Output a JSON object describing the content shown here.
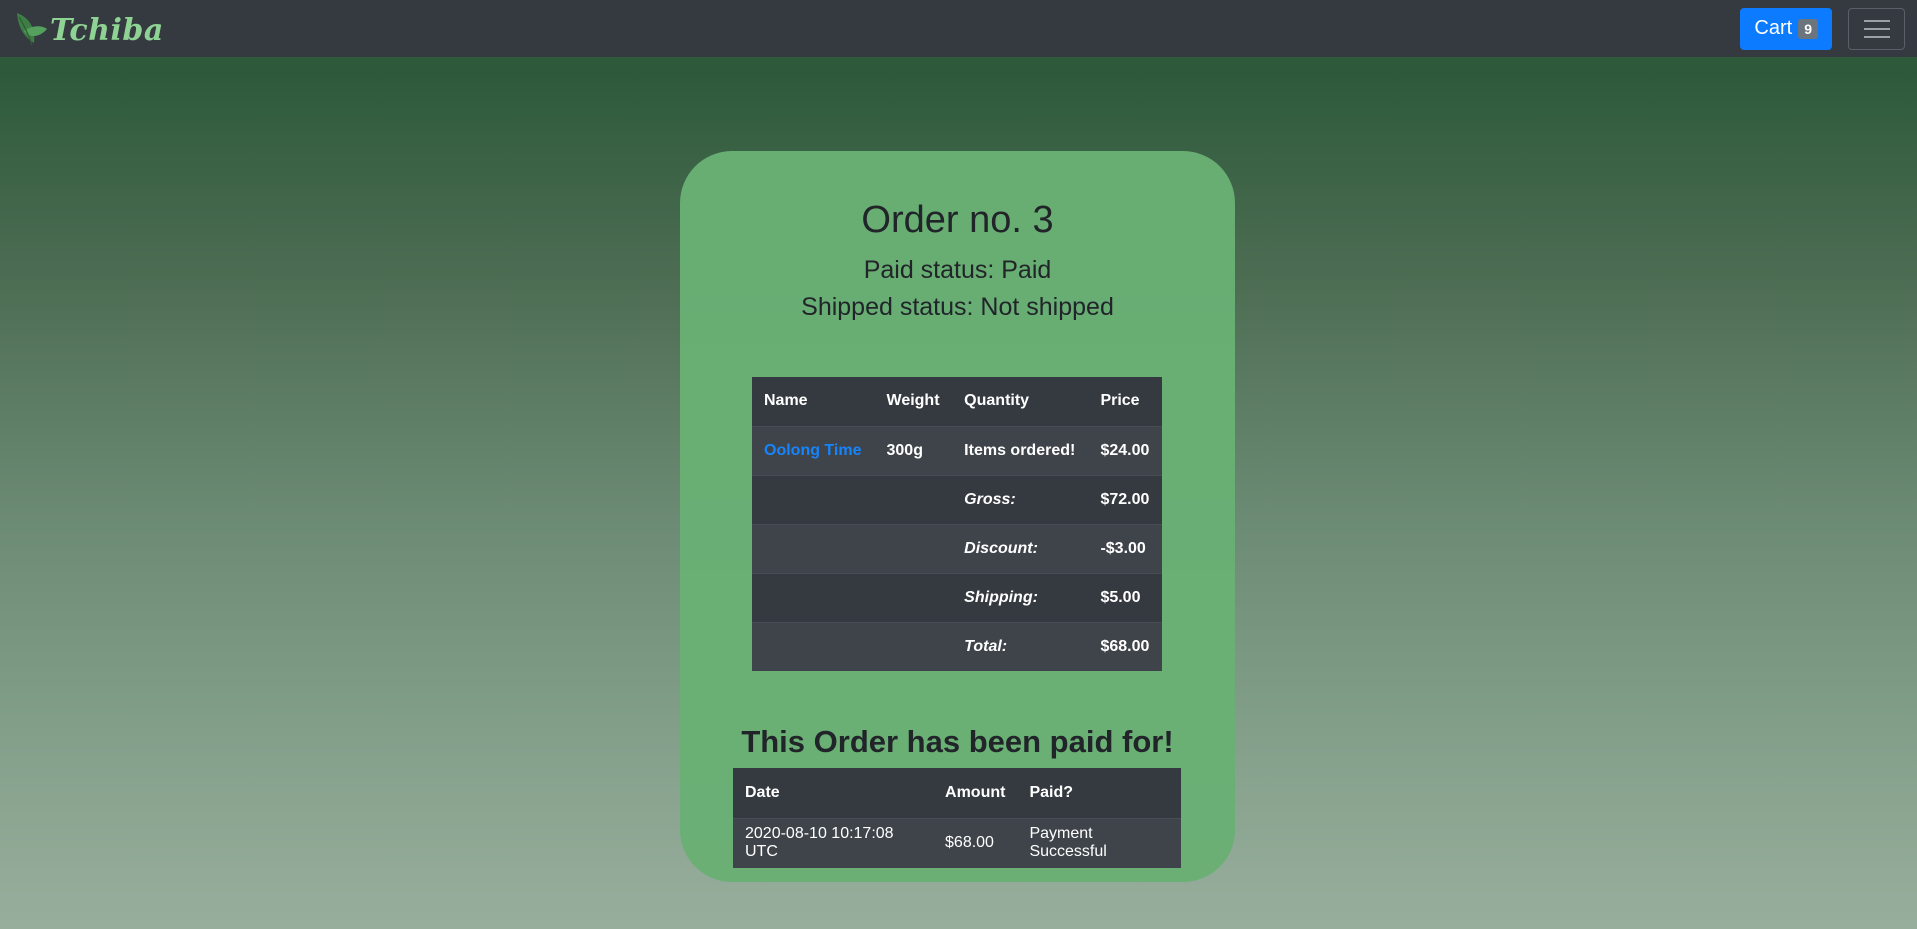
{
  "navbar": {
    "brand": "Tchiba",
    "cart_label": "Cart",
    "cart_count": "9",
    "brand_color": "#8fd394",
    "cart_color": "#0d7bff"
  },
  "order": {
    "title": "Order no. 3",
    "paid_status": "Paid status: Paid",
    "shipped_status": "Shipped status: Not shipped",
    "table": {
      "headers": [
        "Name",
        "Weight",
        "Quantity",
        "Price"
      ],
      "item": {
        "name": "Oolong Time",
        "weight": "300g",
        "quantity": "Items ordered!",
        "price": "$24.00"
      },
      "summary": [
        {
          "label": "Gross:",
          "value": "$72.00"
        },
        {
          "label": "Discount:",
          "value": "-$3.00"
        },
        {
          "label": "Shipping:",
          "value": "$5.00"
        },
        {
          "label": "Total:",
          "value": "$68.00"
        }
      ]
    }
  },
  "payment": {
    "heading": "This Order has been paid for!",
    "headers": [
      "Date",
      "Amount",
      "Paid?"
    ],
    "rows": [
      {
        "date": "2020-08-10 10:17:08 UTC",
        "amount": "$68.00",
        "status": "Payment Successful"
      }
    ]
  },
  "icons": {
    "brand": "leaf-icon",
    "menu": "hamburger-menu-icon"
  }
}
